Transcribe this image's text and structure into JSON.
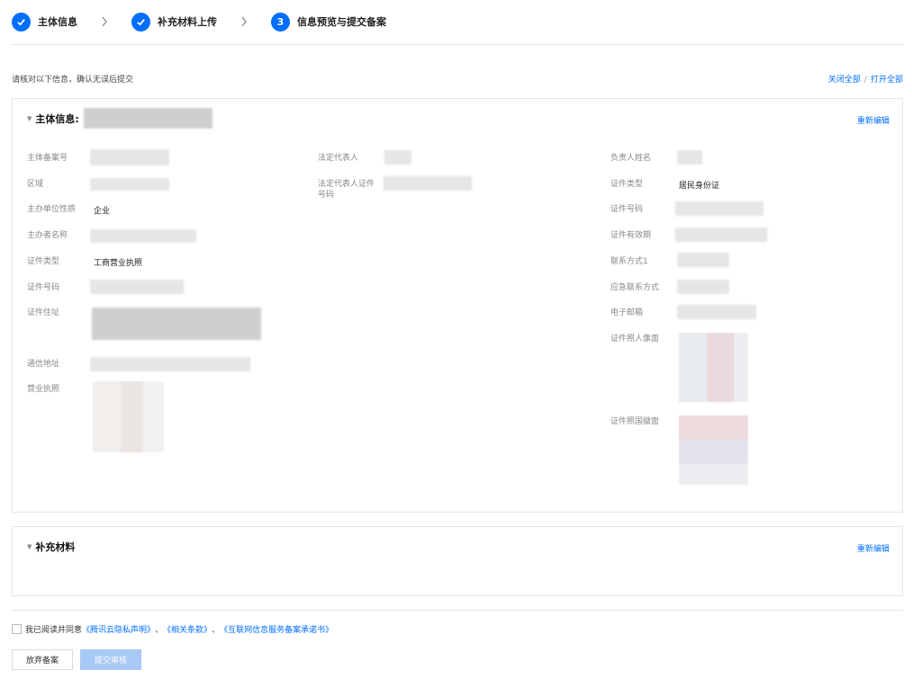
{
  "steps": [
    {
      "label": "主体信息",
      "state": "done"
    },
    {
      "label": "补充材料上传",
      "state": "done"
    },
    {
      "label": "信息预览与提交备案",
      "number": "3",
      "state": "active"
    }
  ],
  "notice": "请核对以下信息，确认无误后提交",
  "toggle": {
    "close_all": "关闭全部",
    "separator": "/",
    "open_all": "打开全部"
  },
  "main_panel": {
    "title": "主体信息:",
    "reedit": "重新编辑",
    "col1": {
      "record_no_label": "主体备案号",
      "region_label": "区域",
      "nature_label": "主办单位性质",
      "nature_value": "企业",
      "sponsor_name_label": "主办者名称",
      "cert_type_label": "证件类型",
      "cert_type_value": "工商营业执照",
      "cert_no_label": "证件号码",
      "cert_addr_label": "证件住址",
      "mail_addr_label": "通信地址",
      "license_label": "营业执照"
    },
    "col2": {
      "legal_rep_label": "法定代表人",
      "legal_rep_id_label": "法定代表人证件号码"
    },
    "col3": {
      "principal_label": "负责人姓名",
      "id_type_label": "证件类型",
      "id_type_value": "居民身份证",
      "id_no_label": "证件号码",
      "validity_label": "证件有效期",
      "contact1_label": "联系方式1",
      "emergency_label": "应急联系方式",
      "email_label": "电子邮箱",
      "front_photo_label": "证件照人像面",
      "back_photo_label": "证件照国徽面"
    }
  },
  "supp_panel": {
    "title": "补充材料",
    "reedit": "重新编辑"
  },
  "agreement": {
    "prefix": "我已阅读并同意",
    "link1": "《腾讯云隐私声明》",
    "sep1": "、",
    "link2": "《相关条款》",
    "sep2": "、",
    "link3": "《互联网信息服务备案承诺书》"
  },
  "buttons": {
    "abandon": "放弃备案",
    "submit": "提交审核"
  },
  "colors": {
    "accent": "#006eff",
    "disabled_button": "#a8c8f5"
  }
}
